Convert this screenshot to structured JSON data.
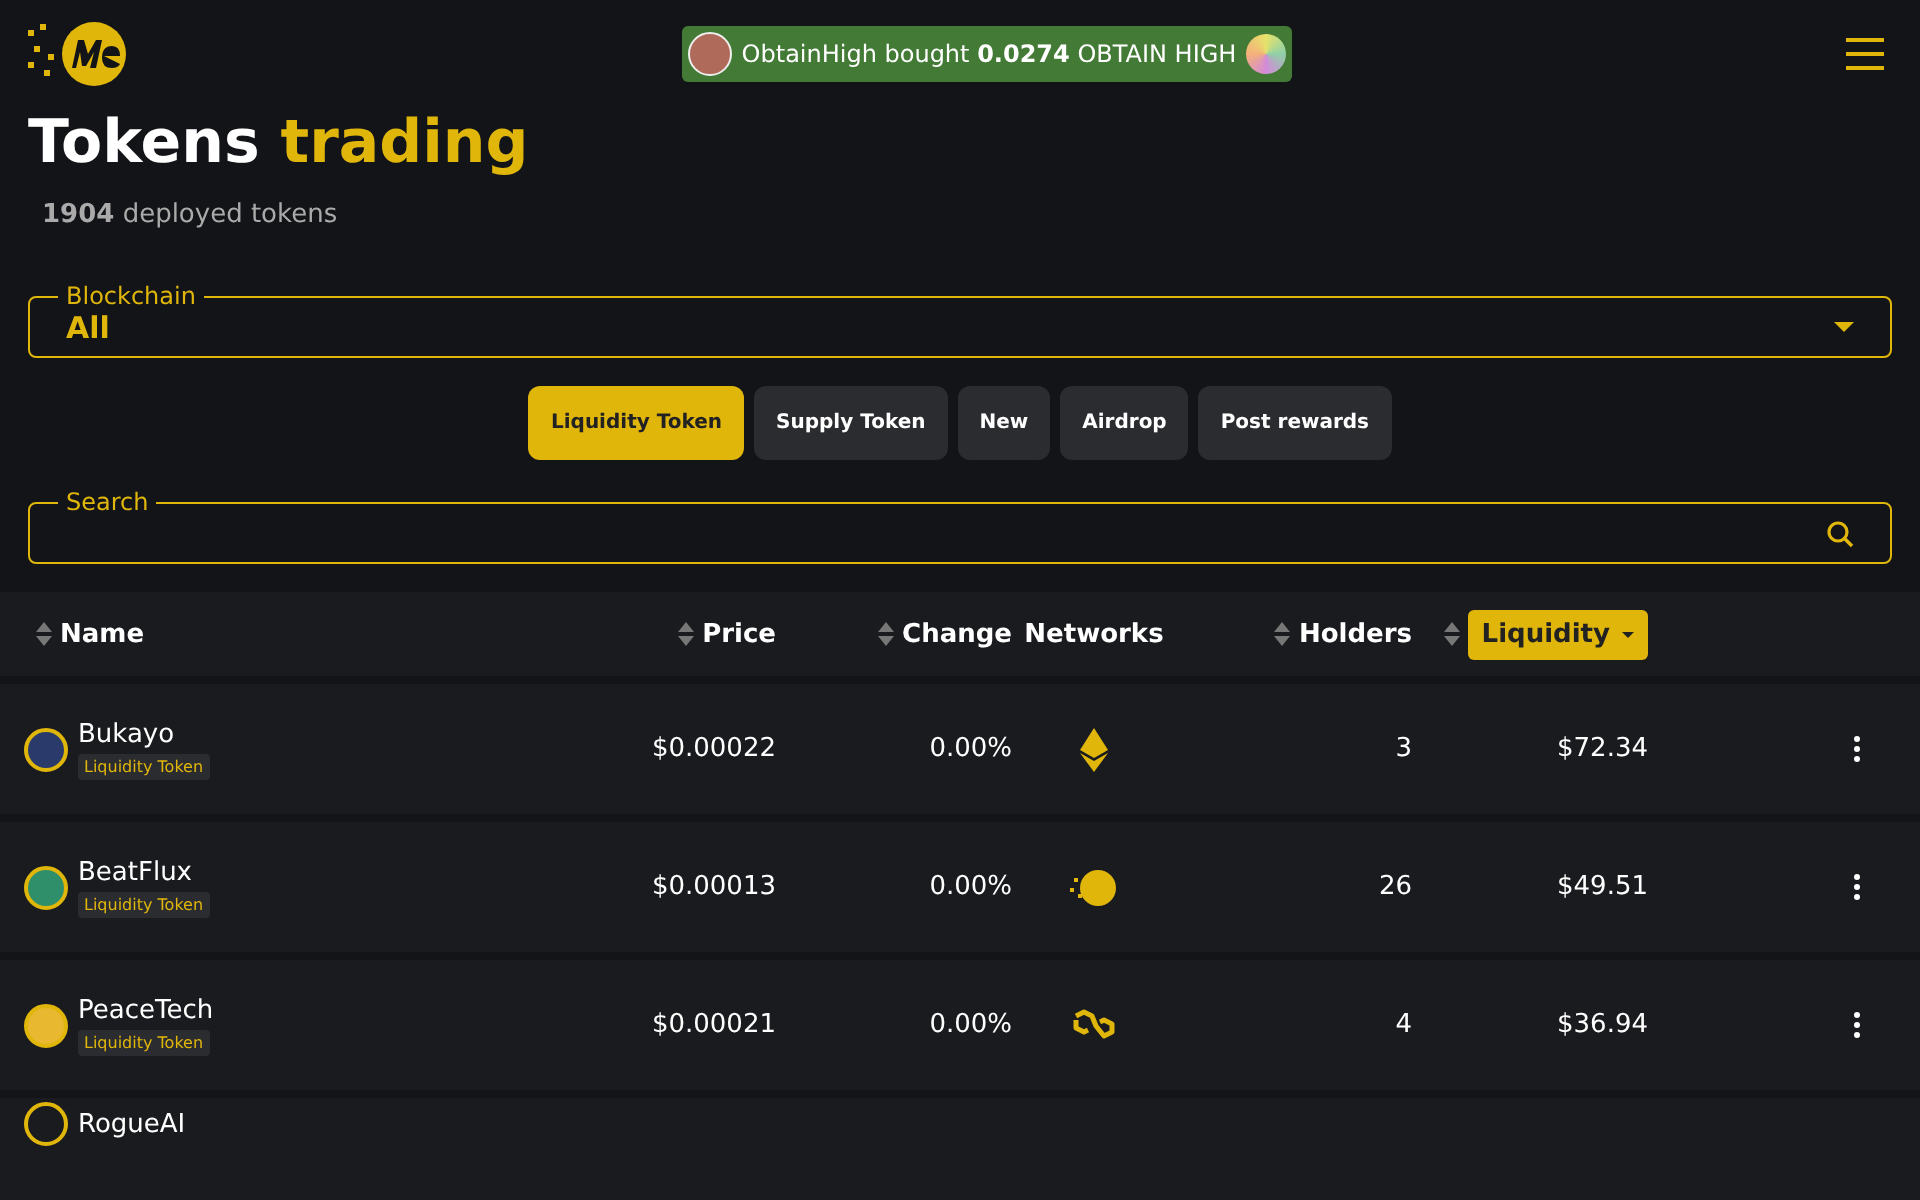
{
  "header": {
    "notification": {
      "user": "ObtainHigh",
      "action": "bought",
      "amount": "0.0274",
      "token": "OBTAIN HIGH"
    }
  },
  "title": {
    "main": "Tokens",
    "accent": "trading"
  },
  "subtitle": {
    "count": "1904",
    "text": "deployed tokens"
  },
  "blockchain": {
    "label": "Blockchain",
    "value": "All"
  },
  "filters": [
    {
      "label": "Liquidity Token",
      "selected": true
    },
    {
      "label": "Supply Token",
      "selected": false
    },
    {
      "label": "New",
      "selected": false
    },
    {
      "label": "Airdrop",
      "selected": false
    },
    {
      "label": "Post rewards",
      "selected": false
    }
  ],
  "search": {
    "label": "Search"
  },
  "table": {
    "columns": [
      {
        "label": "Name",
        "sortable": true,
        "selected": false
      },
      {
        "label": "Price",
        "sortable": true,
        "selected": false
      },
      {
        "label": "Change",
        "sortable": true,
        "selected": false
      },
      {
        "label": "Networks",
        "sortable": false,
        "selected": false
      },
      {
        "label": "Holders",
        "sortable": true,
        "selected": false
      },
      {
        "label": "Liquidity",
        "sortable": true,
        "selected": true
      }
    ],
    "rows": [
      {
        "name": "Bukayo",
        "tag": "Liquidity Token",
        "price": "$0.00022",
        "change": "0.00%",
        "network": {
          "kind": "ethereum"
        },
        "holders": "3",
        "liquidity": "$72.34",
        "color": "#2a3a6a"
      },
      {
        "name": "BeatFlux",
        "tag": "Liquidity Token",
        "price": "$0.00013",
        "change": "0.00%",
        "network": {
          "kind": "me"
        },
        "holders": "26",
        "liquidity": "$49.51",
        "color": "#2f8f6a"
      },
      {
        "name": "PeaceTech",
        "tag": "Liquidity Token",
        "price": "$0.00021",
        "change": "0.00%",
        "network": {
          "kind": "polygon"
        },
        "holders": "4",
        "liquidity": "$36.94",
        "color": "#e8b830"
      },
      {
        "name": "RogueAI"
      }
    ]
  }
}
